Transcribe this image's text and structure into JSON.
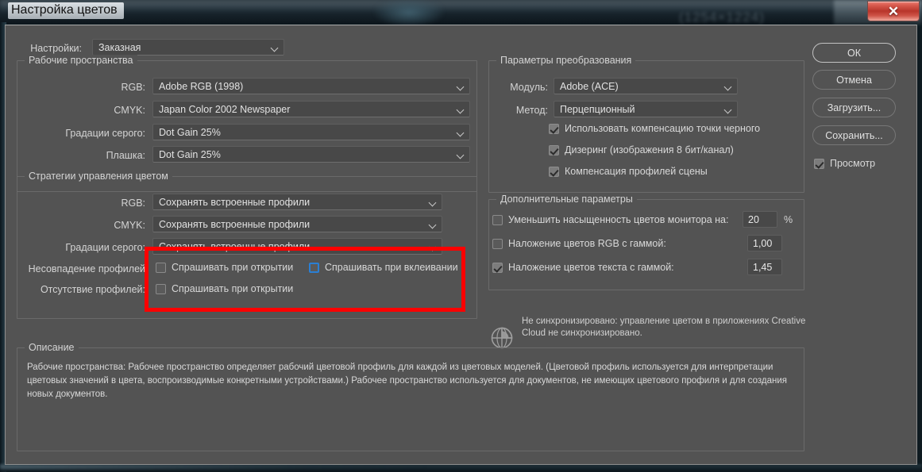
{
  "window": {
    "title": "Настройка цветов",
    "close_icon": "close-icon",
    "close_label": "✕",
    "backdrop_ghost_text": "(1254×1224)"
  },
  "settings_row": {
    "label": "Настройки:",
    "value": "Заказная"
  },
  "working_spaces": {
    "legend": "Рабочие пространства",
    "rows": [
      {
        "label": "RGB:",
        "value": "Adobe RGB (1998)"
      },
      {
        "label": "CMYK:",
        "value": "Japan Color 2002 Newspaper"
      },
      {
        "label": "Градации серого:",
        "value": "Dot Gain 25%"
      },
      {
        "label": "Плашка:",
        "value": "Dot Gain 25%"
      }
    ]
  },
  "color_management_policies": {
    "legend": "Стратегии управления цветом",
    "rows": [
      {
        "label": "RGB:",
        "value": "Сохранять встроенные профили"
      },
      {
        "label": "CMYK:",
        "value": "Сохранять встроенные профили"
      },
      {
        "label": "Градации серого:",
        "value": "Сохранять встроенные профили"
      }
    ],
    "mismatch_label": "Несовпадение профилей",
    "missing_label": "Отсутствие профилей:",
    "ask_when_opening_mismatch": "Спрашивать при открытии",
    "ask_when_pasting": "Спрашивать при вклеивании",
    "ask_when_opening_missing": "Спрашивать при открытии"
  },
  "conversion_options": {
    "legend": "Параметры преобразования",
    "engine_label": "Модуль:",
    "engine_value": "Adobe (ACE)",
    "intent_label": "Метод:",
    "intent_value": "Перцепционный",
    "checkboxes": [
      {
        "label": "Использовать компенсацию точки черного",
        "checked": true
      },
      {
        "label": "Дизеринг (изображения 8 бит/канал)",
        "checked": true
      },
      {
        "label": "Компенсация профилей сцены",
        "checked": true
      }
    ]
  },
  "advanced_controls": {
    "legend": "Дополнительные параметры",
    "desaturate_label": "Уменьшить насыщенность цветов монитора на:",
    "desaturate_value": "20",
    "desaturate_unit": "%",
    "blend_rgb_label": "Наложение цветов RGB с гаммой:",
    "blend_rgb_value": "1,00",
    "blend_text_label": "Наложение цветов текста с гаммой:",
    "blend_text_value": "1,45"
  },
  "sync_notice": {
    "icon": "creative-cloud-icon",
    "text": "Не синхронизировано: управление цветом в приложениях Creative Cloud не синхронизировано."
  },
  "buttons": {
    "ok": "ОК",
    "cancel": "Отмена",
    "load": "Загрузить...",
    "save": "Сохранить...",
    "preview": "Просмотр"
  },
  "description": {
    "legend": "Описание",
    "text": "Рабочие пространства:  Рабочее пространство определяет рабочий цветовой профиль для каждой из цветовых моделей.  (Цветовой профиль используется для интерпретации цветовых значений в цвета, воспроизводимые конкретными устройствами.)  Рабочее пространство используется для документов, не имеющих цветового профиля и для создания новых документов."
  },
  "annotation": {
    "highlight_color": "#fe0000"
  }
}
